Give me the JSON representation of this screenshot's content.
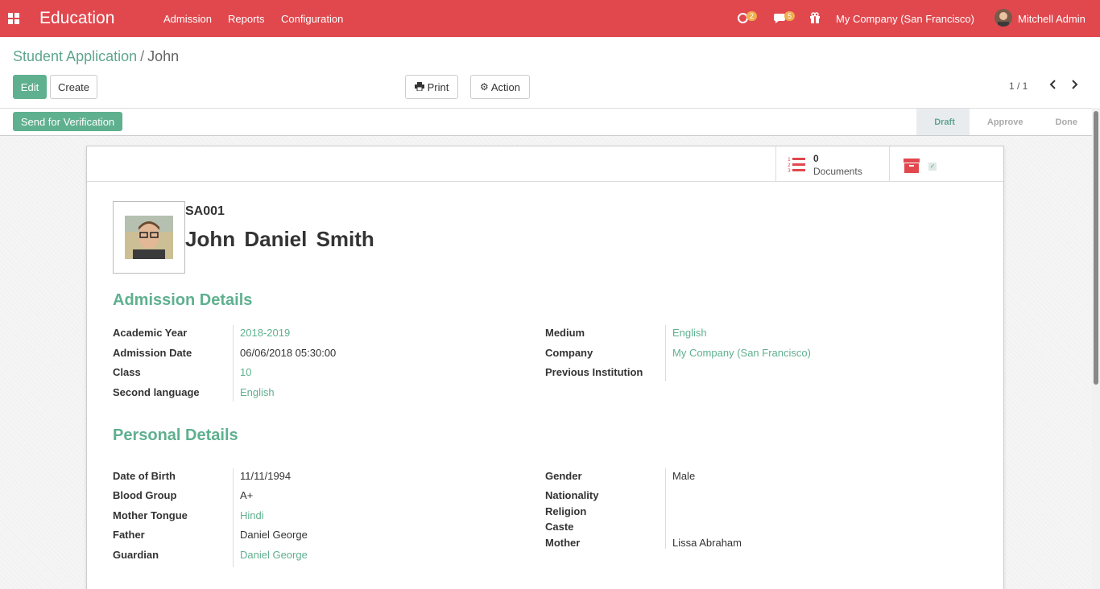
{
  "navbar": {
    "app_title": "Education",
    "menu": [
      "Admission",
      "Reports",
      "Configuration"
    ],
    "activity_count": "2",
    "message_count": "5",
    "company": "My Company (San Francisco)",
    "user": "Mitchell Admin"
  },
  "breadcrumb": {
    "parent": "Student Application",
    "separator": "/",
    "current": "John"
  },
  "buttons": {
    "edit": "Edit",
    "create": "Create",
    "print": "Print",
    "action": "Action",
    "send_verification": "Send for Verification"
  },
  "pager": {
    "value": "1 / 1"
  },
  "status_steps": [
    "Draft",
    "Approve",
    "Done"
  ],
  "active_step": "Draft",
  "stat": {
    "count": "0",
    "label": "Documents"
  },
  "student": {
    "id": "SA001",
    "name": "John Daniel Smith"
  },
  "sections": {
    "admission": "Admission Details",
    "personal": "Personal Details"
  },
  "admission_left": [
    {
      "label": "Academic Year",
      "value": "2018-2019"
    },
    {
      "label": "Admission Date",
      "value": "06/06/2018 05:30:00"
    },
    {
      "label": "Class",
      "value": "10"
    },
    {
      "label": "Second language",
      "value": "English"
    }
  ],
  "admission_right": [
    {
      "label": "Medium",
      "value": "English"
    },
    {
      "label": "Company",
      "value": "My Company (San Francisco)"
    },
    {
      "label": "Previous Institution",
      "value": ""
    }
  ],
  "personal_left": [
    {
      "label": "Date of Birth",
      "value": "11/11/1994"
    },
    {
      "label": "Blood Group",
      "value": "A+"
    },
    {
      "label": "Mother Tongue",
      "value": "Hindi"
    },
    {
      "label": "Father",
      "value": "Daniel George"
    },
    {
      "label": "Guardian",
      "value": "Daniel George"
    }
  ],
  "personal_right": [
    {
      "label": "Gender",
      "value": "Male"
    },
    {
      "label": "Nationality",
      "value": ""
    },
    {
      "label": "Religion",
      "value": ""
    },
    {
      "label": "Caste",
      "value": ""
    },
    {
      "label": "Mother",
      "value": "Lissa Abraham"
    }
  ],
  "colors": {
    "navbar": "#e0484e",
    "accent": "#5fb08f",
    "badge": "#f0ad4e"
  }
}
